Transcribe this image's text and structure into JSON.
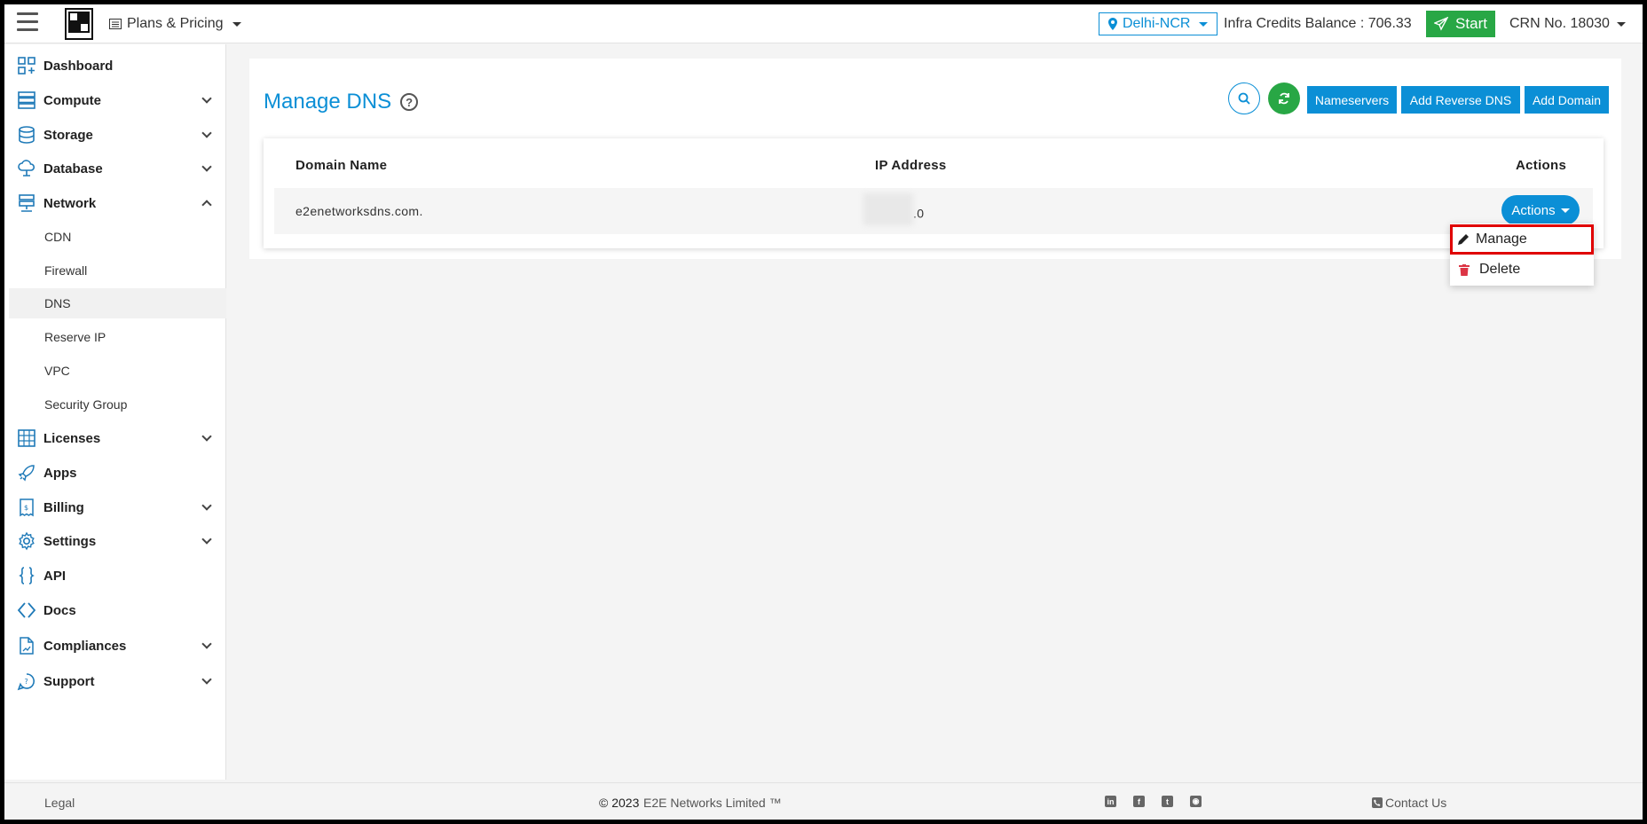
{
  "header": {
    "plans_label": "Plans & Pricing",
    "region": "Delhi-NCR",
    "credits": "Infra Credits Balance : 706.33",
    "start_label": "Start",
    "crn": "CRN No. 18030"
  },
  "sidebar": {
    "items": [
      {
        "label": "Dashboard",
        "icon": "dashboard-icon"
      },
      {
        "label": "Compute",
        "icon": "server-icon"
      },
      {
        "label": "Storage",
        "icon": "database-icon"
      },
      {
        "label": "Database",
        "icon": "cloud-icon"
      },
      {
        "label": "Network",
        "icon": "network-icon"
      },
      {
        "label": "Licenses",
        "icon": "grid-icon"
      },
      {
        "label": "Apps",
        "icon": "rocket-icon"
      },
      {
        "label": "Billing",
        "icon": "billing-icon"
      },
      {
        "label": "Settings",
        "icon": "gear-icon"
      },
      {
        "label": "API",
        "icon": "braces-icon"
      },
      {
        "label": "Docs",
        "icon": "code-icon"
      },
      {
        "label": "Compliances",
        "icon": "file-icon"
      },
      {
        "label": "Support",
        "icon": "support-icon"
      }
    ],
    "network_sub": [
      "CDN",
      "Firewall",
      "DNS",
      "Reserve IP",
      "VPC",
      "Security Group"
    ]
  },
  "main": {
    "title": "Manage DNS",
    "buttons": {
      "nameservers": "Nameservers",
      "reverse_dns": "Add Reverse DNS",
      "add_domain": "Add Domain"
    },
    "columns": {
      "domain": "Domain Name",
      "ip": "IP Address",
      "actions": "Actions"
    },
    "rows": [
      {
        "domain": "e2enetworksdns.com.",
        "ip_suffix": ".0",
        "action_label": "Actions"
      }
    ],
    "dropdown": {
      "manage": "Manage",
      "delete": "Delete"
    }
  },
  "footer": {
    "legal": "Legal",
    "copyright_prefix": "© 2023",
    "company": "E2E Networks Limited ™",
    "contact": "Contact Us"
  },
  "colors": {
    "accent": "#0b8fd6",
    "success": "#28a745",
    "danger": "#e00000"
  }
}
